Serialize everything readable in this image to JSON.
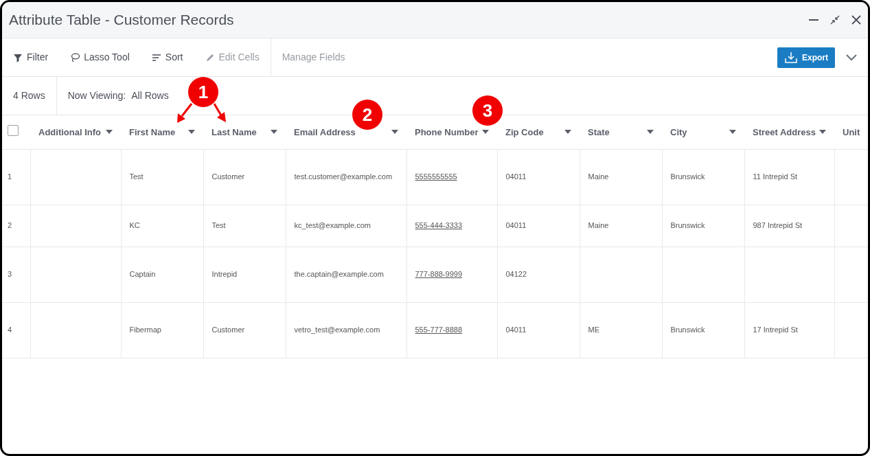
{
  "window": {
    "title": "Attribute Table - Customer Records"
  },
  "toolbar": [
    {
      "label": "Filter",
      "kind": "filter",
      "disabled": false
    },
    {
      "label": "Lasso Tool",
      "kind": "lasso",
      "disabled": false
    },
    {
      "label": "Sort",
      "kind": "sort",
      "disabled": false
    },
    {
      "label": "Edit Cells",
      "kind": "edit",
      "disabled": true
    },
    {
      "label": "Manage Fields",
      "kind": "plain",
      "disabled": true
    }
  ],
  "export_button": {
    "label": "Export"
  },
  "info_bar": {
    "row_count": "4 Rows",
    "viewing_label": "Now Viewing:",
    "viewing_value": "All Rows"
  },
  "table": {
    "select_all_checked": false,
    "columns": [
      {
        "label": "Additional Info",
        "kind": "text"
      },
      {
        "label": "First Name",
        "kind": "text"
      },
      {
        "label": "Last Name",
        "kind": "text"
      },
      {
        "label": "Email Address",
        "kind": "text"
      },
      {
        "label": "Phone Number",
        "kind": "phone"
      },
      {
        "label": "Zip Code",
        "kind": "text"
      },
      {
        "label": "State",
        "kind": "text"
      },
      {
        "label": "City",
        "kind": "text"
      },
      {
        "label": "Street Address",
        "kind": "text"
      },
      {
        "label": "Unit",
        "kind": "plain"
      }
    ],
    "rows": [
      {
        "index": "1",
        "cells": [
          null,
          "Test",
          "Customer",
          "test.customer@example.com",
          "5555555555",
          "04011",
          "Maine",
          "Brunswick",
          "11 Intrepid St",
          null
        ]
      },
      {
        "index": "2",
        "cells": [
          null,
          "KC",
          "Test",
          "kc_test@example.com",
          "555-444-3333",
          "04011",
          "Maine",
          "Brunswick",
          "987 Intrepid St",
          null
        ]
      },
      {
        "index": "3",
        "cells": [
          null,
          "Captain",
          "Intrepid",
          "the.captain@example.com",
          "777-888-9999",
          "04122",
          null,
          null,
          null,
          null
        ]
      },
      {
        "index": "4",
        "cells": [
          null,
          "Fibermap",
          "Customer",
          "vetro_test@example.com",
          "555-777-8888",
          "04011",
          "ME",
          "Brunswick",
          "17 Intrepid St",
          null
        ]
      }
    ]
  },
  "annotations": [
    {
      "label": "1"
    },
    {
      "label": "2"
    },
    {
      "label": "3"
    }
  ]
}
